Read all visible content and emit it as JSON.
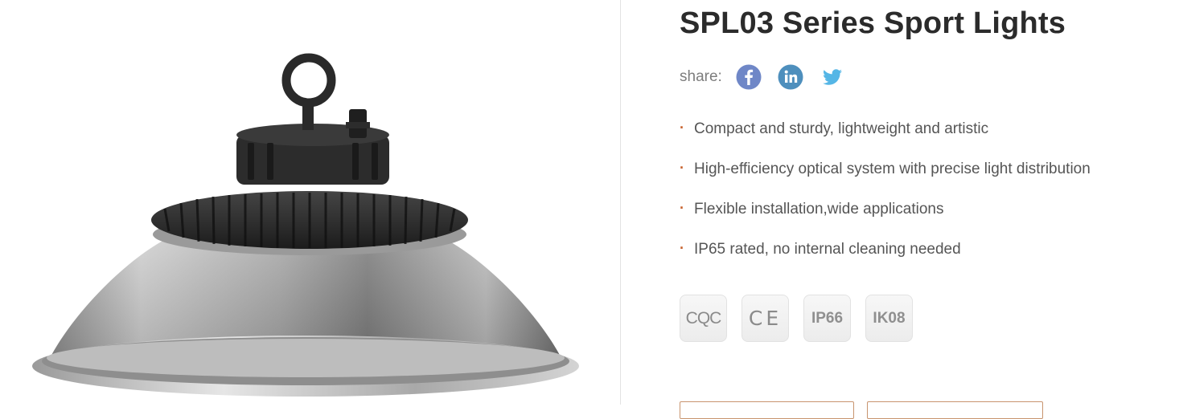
{
  "product": {
    "title": "SPL03 Series Sport Lights",
    "image_alt": "SPL03 high bay sport light fixture"
  },
  "share": {
    "label": "share:",
    "icons": [
      "facebook-icon",
      "linkedin-icon",
      "twitter-icon"
    ]
  },
  "features": [
    "Compact and sturdy, lightweight and artistic",
    "High-efficiency optical system with precise light distribution",
    "Flexible installation,wide applications",
    "IP65 rated, no internal cleaning needed"
  ],
  "certifications": [
    "CQC",
    "CE",
    "IP66",
    "IK08"
  ],
  "colors": {
    "bullet": "#c8622d",
    "facebook": "#6f87c7",
    "linkedin": "#4e8fbd",
    "twitter": "#55b6e6",
    "title": "#2b2b2b",
    "text": "#555555"
  }
}
